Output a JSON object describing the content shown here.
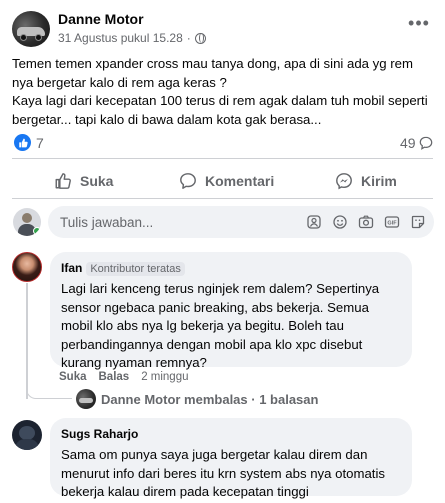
{
  "post": {
    "author": "Danne Motor",
    "date": "31 Agustus pukul 15.28",
    "more_icon": "more-horizontal-icon",
    "text_line1": "Temen temen xpander cross mau tanya dong, apa di sini ada yg rem nya bergetar kalo di rem aga keras ?",
    "text_line2": "Kaya lagi dari kecepatan 100 terus di rem agak dalam tuh mobil seperti bergetar... tapi kalo di bawa dalam kota gak berasa...",
    "like_count": "7",
    "comment_count": "49",
    "colors": {
      "like_blue": "#1877f2",
      "secondary_text": "#65676b",
      "bubble_bg": "#f0f2f5"
    }
  },
  "actions": {
    "like": "Suka",
    "comment": "Komentari",
    "send": "Kirim"
  },
  "composer": {
    "placeholder": "Tulis jawaban..."
  },
  "comments": [
    {
      "author": "Ifan",
      "badge": "Kontributor teratas",
      "text": "Lagi lari kenceng terus nginjek rem dalem? Sepertinya sensor ngebaca panic breaking, abs bekerja. Semua mobil klo abs nya lg bekerja ya begitu. Boleh tau perbandingannya dengan mobil apa klo xpc disebut kurang nyaman remnya?",
      "like_label": "Suka",
      "reply_label": "Balas",
      "time": "2 minggu",
      "reply_summary": "Danne Motor membalas · 1 balasan"
    },
    {
      "author": "Sugs Raharjo",
      "text": "Sama om punya saya juga bergetar kalau direm dan menurut info dari beres itu krn system abs nya otomatis bekerja kalau direm pada kecepatan tinggi"
    }
  ]
}
